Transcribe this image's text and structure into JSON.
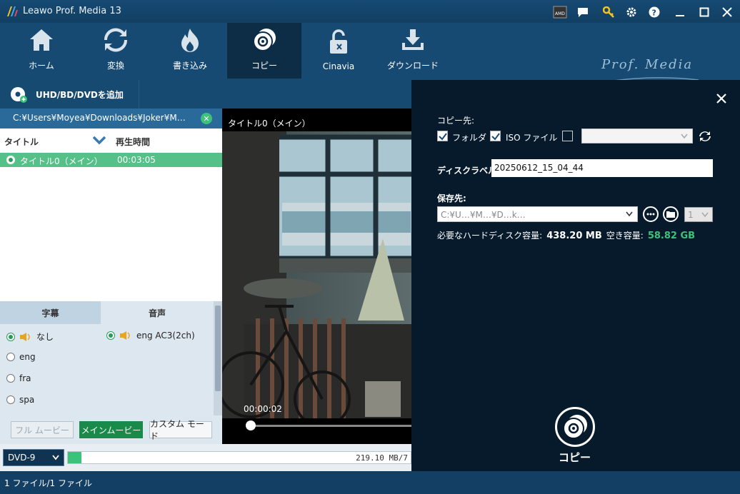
{
  "app": {
    "title": "Leawo Prof. Media 13",
    "brand": "Prof. Media"
  },
  "nav": [
    {
      "label": "ホーム",
      "icon": "home-icon"
    },
    {
      "label": "変換",
      "icon": "convert-icon"
    },
    {
      "label": "書き込み",
      "icon": "burn-icon"
    },
    {
      "label": "コピー",
      "icon": "copy-disc-icon",
      "active": true
    },
    {
      "label": "Cinavia",
      "icon": "cinavia-lock-icon"
    },
    {
      "label": "ダウンロード",
      "icon": "download-icon"
    }
  ],
  "toolbar": {
    "add_label": "UHD/BD/DVDを追加"
  },
  "source": {
    "path": "C:¥Users¥Moyea¥Downloads¥Joker¥M…"
  },
  "titles": {
    "col_title": "タイトル",
    "col_duration": "再生時間",
    "rows": [
      {
        "name": "タイトル0（メイン）",
        "duration": "00:03:05"
      }
    ]
  },
  "subtitles": {
    "header": "字幕",
    "options": [
      "なし",
      "eng",
      "fra",
      "spa"
    ]
  },
  "audio": {
    "header": "音声",
    "options": [
      "eng AC3(2ch)"
    ]
  },
  "modes": {
    "full": "フル ムービー",
    "main": "メインムービー",
    "custom": "カスタム モード"
  },
  "preview": {
    "title": "タイトル0（メイン）",
    "timecode": "00:00:02"
  },
  "disc": {
    "type": "DVD-9",
    "size_text": "219.10 MB/7",
    "progress": 0.04
  },
  "status": {
    "files": "1 ファイル/1 ファイル"
  },
  "copy_panel": {
    "dest_label": "コピー先:",
    "folder_label": "フォルダ",
    "iso_label": "ISO ファイル",
    "disc_label_label": "ディスクラベル:",
    "disc_label_value": "20250612_15_04_44",
    "save_label": "保存先:",
    "save_path": "C:¥U…¥M…¥D…k…",
    "count": "1",
    "required_label": "必要なハードディスク容量:",
    "required_value": "438.20 MB",
    "free_label": "空き容量:",
    "free_value": "58.82 GB",
    "copy_button": "コピー"
  },
  "colors": {
    "accent_green": "#3cc27a",
    "nav_bg": "#164a72",
    "panel_dark": "#061a2c"
  }
}
